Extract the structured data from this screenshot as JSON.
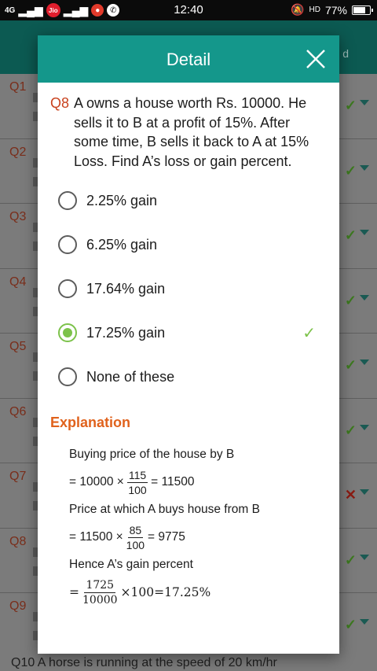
{
  "status_bar": {
    "network_label": "4G",
    "carrier_badge": "Jio",
    "time": "12:40",
    "hd_label": "HD",
    "battery": "77%",
    "battery_level": 0.77
  },
  "background": {
    "appbar_partial_text": "d",
    "rows": [
      {
        "qno": "Q1",
        "mark": "✓"
      },
      {
        "qno": "Q2",
        "mark": "✓"
      },
      {
        "qno": "Q3",
        "mark": "✓"
      },
      {
        "qno": "Q4",
        "mark": "✓"
      },
      {
        "qno": "Q5",
        "mark": "✓"
      },
      {
        "qno": "Q6",
        "mark": "✓"
      },
      {
        "qno": "Q7",
        "mark": "✕"
      },
      {
        "qno": "Q8",
        "mark": "✓"
      },
      {
        "qno": "Q9",
        "mark": "✓"
      }
    ],
    "bottom_text": "Q10 A horse is running at the speed of 20 km/hr"
  },
  "dialog": {
    "title": "Detail",
    "close_icon": "close-icon",
    "question_no": "Q8",
    "question_text": "A owns a house worth Rs. 10000. He sells it to B at a profit of 15%. After some time, B sells it back to A at 15% Loss. Find A’s loss or gain percent.",
    "options": [
      {
        "label": "2.25% gain",
        "selected": false,
        "correct": false
      },
      {
        "label": "6.25% gain",
        "selected": false,
        "correct": false
      },
      {
        "label": "17.64% gain",
        "selected": false,
        "correct": false
      },
      {
        "label": "17.25% gain",
        "selected": true,
        "correct": true
      },
      {
        "label": "None of these",
        "selected": false,
        "correct": false
      }
    ],
    "correct_mark": "✓",
    "explanation_heading": "Explanation",
    "explanation": {
      "line1": "Buying  price of the house by B",
      "eq1_prefix": "= 10000 ×",
      "eq1_num": "115",
      "eq1_den": "100",
      "eq1_suffix": "= 11500",
      "line2": "Price at which A buys house from B",
      "eq2_prefix": "= 11500 ×",
      "eq2_num": "85",
      "eq2_den": "100",
      "eq2_suffix": "= 9775",
      "line3": "Hence A’s gain percent",
      "eq3_prefix": "=",
      "eq3_num": "1725",
      "eq3_den": "10000",
      "eq3_suffix": "×100=17.25%"
    }
  }
}
